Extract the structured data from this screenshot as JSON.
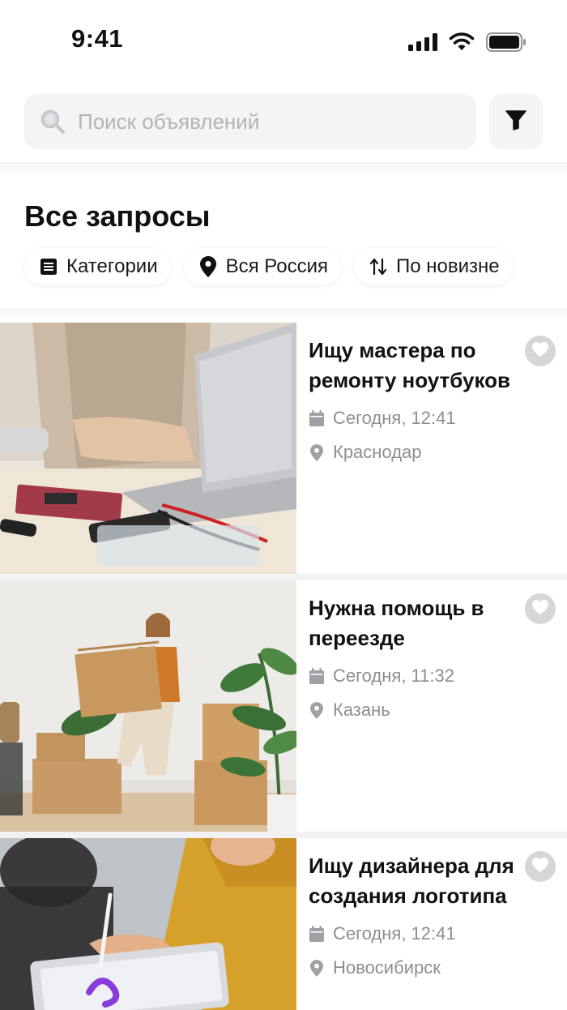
{
  "status_bar": {
    "time": "9:41"
  },
  "search": {
    "placeholder": "Поиск объявлений",
    "value": ""
  },
  "section": {
    "title": "Все запросы"
  },
  "chips": [
    {
      "label": "Категории",
      "icon": "list-icon"
    },
    {
      "label": "Вся Россия",
      "icon": "location-pin-icon"
    },
    {
      "label": "По новизне",
      "icon": "sort-icon"
    }
  ],
  "listings": [
    {
      "title": "Ищу мастера по ремонту ноутбуков",
      "date": "Сегодня, 12:41",
      "city": "Краснодар",
      "image": "laptop-repair-photo"
    },
    {
      "title": "Нужна помощь в переезде",
      "date": "Сегодня, 11:32",
      "city": "Казань",
      "image": "moving-boxes-photo"
    },
    {
      "title": "Ищу дизайнера для создания логотипа",
      "date": "Сегодня, 12:41",
      "city": "Новосибирск",
      "image": "designer-tablet-photo"
    }
  ],
  "colors": {
    "text": "#111111",
    "muted": "#8e8e93",
    "search_bg": "#f4f4f6",
    "fav_bg": "#d6d6d9"
  }
}
